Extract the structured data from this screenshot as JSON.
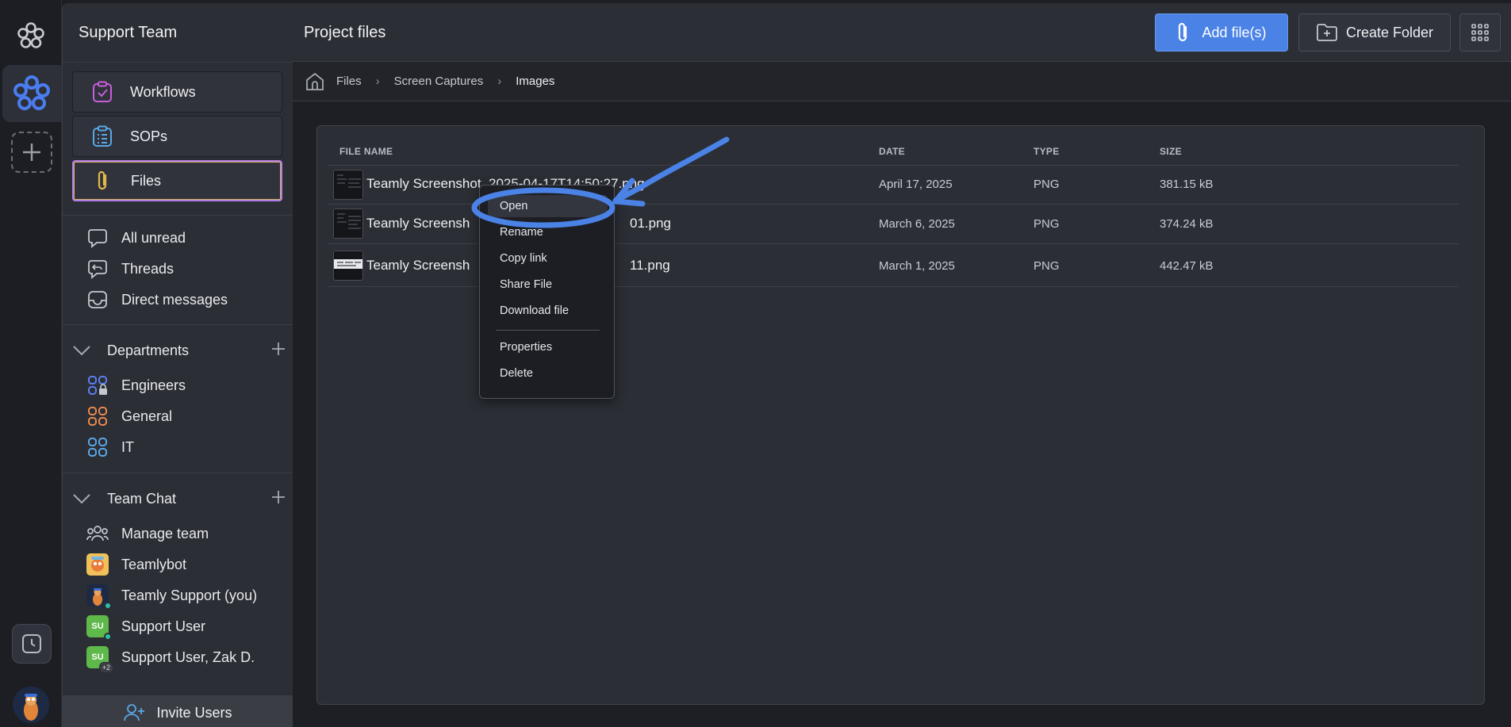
{
  "rail": {
    "logo_icon": "flower-logo-icon",
    "workspace_icon": "workspace-flower-icon",
    "add_icon": "plus-icon",
    "history_icon": "clock-icon"
  },
  "sidebar": {
    "title": "Support Team",
    "nav": [
      {
        "label": "Workflows",
        "icon": "clipboard-check-icon",
        "color": "#c65fd8"
      },
      {
        "label": "SOPs",
        "icon": "clipboard-list-icon",
        "color": "#5aa8e6"
      },
      {
        "label": "Files",
        "icon": "paperclip-icon",
        "color": "#e3b94a",
        "active": true
      }
    ],
    "messages": [
      {
        "label": "All unread",
        "icon": "chat-bubble-icon"
      },
      {
        "label": "Threads",
        "icon": "threads-icon"
      },
      {
        "label": "Direct messages",
        "icon": "inbox-icon"
      }
    ],
    "departments": {
      "title": "Departments",
      "items": [
        {
          "label": "Engineers",
          "color": "#5b7ff0"
        },
        {
          "label": "General",
          "color": "#e8894f"
        },
        {
          "label": "IT",
          "color": "#5aa8e6"
        }
      ]
    },
    "team_chat": {
      "title": "Team Chat",
      "items": [
        {
          "label": "Manage team"
        },
        {
          "label": "Teamlybot"
        },
        {
          "label": "Teamly Support (you)"
        },
        {
          "label": "Support User",
          "initials": "SU"
        },
        {
          "label": "Support User, Zak D.",
          "initials": "SU",
          "extra": "+2"
        }
      ]
    },
    "invite_label": "Invite Users"
  },
  "header": {
    "title": "Project files",
    "add_files_label": "Add file(s)",
    "create_folder_label": "Create Folder",
    "colors": {
      "primary": "#4a82e6"
    }
  },
  "breadcrumb": [
    "Files",
    "Screen Captures",
    "Images"
  ],
  "table": {
    "columns": [
      "FILE NAME",
      "DATE",
      "TYPE",
      "SIZE"
    ],
    "rows": [
      {
        "name": "Teamly Screenshot_2025-04-17T14:50:27.png",
        "date": "April 17, 2025",
        "type": "PNG",
        "size": "381.15 kB"
      },
      {
        "name": "Teamly Screensh",
        "name_tail": "01.png",
        "date": "March 6, 2025",
        "type": "PNG",
        "size": "374.24 kB"
      },
      {
        "name": "Teamly Screensh",
        "name_tail": "11.png",
        "date": "March 1, 2025",
        "type": "PNG",
        "size": "442.47 kB"
      }
    ]
  },
  "context_menu": {
    "items": [
      "Open",
      "Rename",
      "Copy link",
      "Share File",
      "Download file"
    ],
    "items2": [
      "Properties",
      "Delete"
    ]
  },
  "annotation": {
    "color": "#4a82e6"
  }
}
